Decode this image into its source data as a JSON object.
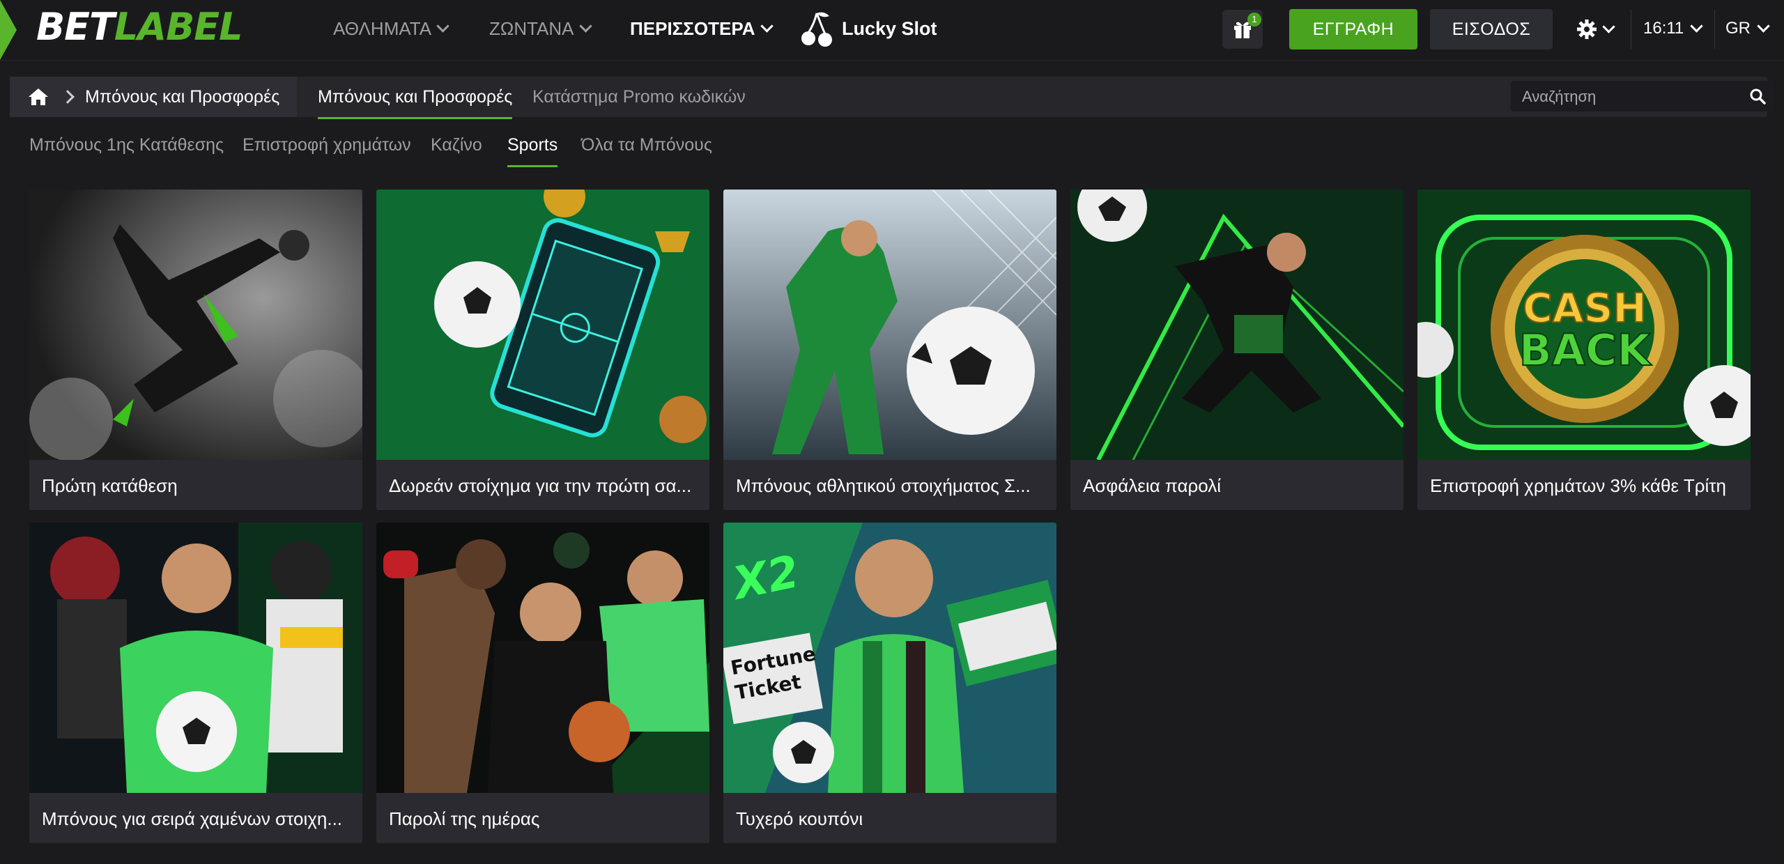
{
  "header": {
    "logo_part1": "BET",
    "logo_part2": "LABEL",
    "nav": [
      {
        "label": "ΑΘΛΗΜΑΤΑ"
      },
      {
        "label": "ΖΩΝΤΑΝΑ"
      },
      {
        "label": "ΠΕΡΙΣΣΟΤΕΡΑ"
      }
    ],
    "lucky_slot": "Lucky Slot",
    "gift_count": "1",
    "register_label": "ΕΓΓΡΑΦΗ",
    "login_label": "ΕΙΣΟΔΟΣ",
    "time": "16:11",
    "language": "GR",
    "colors": {
      "accent": "#58b52c",
      "register_bg": "#4aa31f",
      "background": "#1b1b1e"
    }
  },
  "breadcrumb": {
    "current": "Μπόνους και Προσφορές"
  },
  "subtabs": [
    {
      "label": "Μπόνους και Προσφορές",
      "active": true
    },
    {
      "label": "Κατάστημα Promo κωδικών",
      "active": false
    }
  ],
  "search": {
    "placeholder": "Αναζήτηση"
  },
  "categories": [
    {
      "label": "Μπόνους 1ης Κατάθεσης"
    },
    {
      "label": "Επιστροφή χρημάτων"
    },
    {
      "label": "Καζίνο"
    },
    {
      "label": "Sports",
      "active": true
    },
    {
      "label": "Όλα τα Μπόνους"
    }
  ],
  "promos": [
    {
      "title": "Πρώτη κατάθεση"
    },
    {
      "title": "Δωρεάν στοίχημα για την πρώτη σα..."
    },
    {
      "title": "Μπόνους αθλητικού στοιχήματος Σ..."
    },
    {
      "title": "Ασφάλεια παρολί"
    },
    {
      "title": "Επιστροφή χρημάτων 3% κάθε Τρίτη"
    },
    {
      "title": "Μπόνους για σειρά χαμένων στοιχη..."
    },
    {
      "title": "Παρολί της ημέρας"
    },
    {
      "title": "Τυχερό κουπόνι"
    }
  ],
  "image_text": {
    "cashback_top": "CASH",
    "cashback_bottom": "BACK",
    "fortune": "Fortune",
    "ticket": "Ticket",
    "x2": "X2"
  }
}
